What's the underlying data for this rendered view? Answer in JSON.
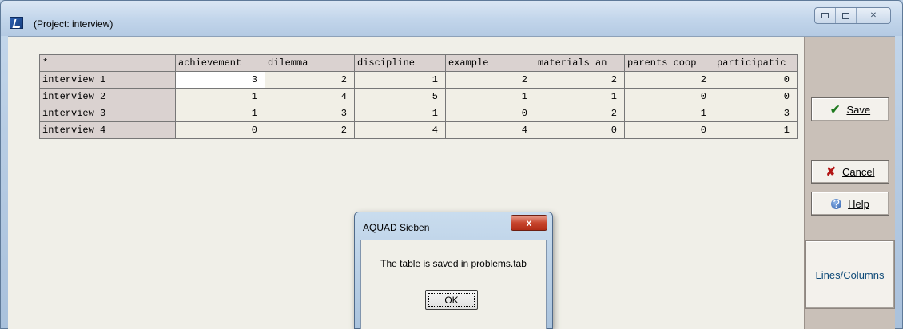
{
  "window": {
    "title": "(Project: interview)"
  },
  "grid": {
    "corner": "*",
    "columns": [
      "achievement",
      "dilemma",
      "discipline",
      "example",
      "materials an",
      "parents coop",
      "participatic"
    ],
    "rows": [
      {
        "label": "interview 1",
        "values": [
          "3",
          "2",
          "1",
          "2",
          "2",
          "2",
          "0"
        ]
      },
      {
        "label": "interview 2",
        "values": [
          "1",
          "4",
          "5",
          "1",
          "1",
          "0",
          "0"
        ]
      },
      {
        "label": "interview 3",
        "values": [
          "1",
          "3",
          "1",
          "0",
          "2",
          "1",
          "3"
        ]
      },
      {
        "label": "interview 4",
        "values": [
          "0",
          "2",
          "4",
          "4",
          "0",
          "0",
          "1"
        ]
      }
    ]
  },
  "side": {
    "save_label": "Save",
    "cancel_label": "Cancel",
    "help_label": "Help",
    "lines_label": "Lines/Columns"
  },
  "dialog": {
    "title": "AQUAD Sieben",
    "close_glyph": "x",
    "message": "The table is saved in problems.tab",
    "ok_label": "OK"
  }
}
